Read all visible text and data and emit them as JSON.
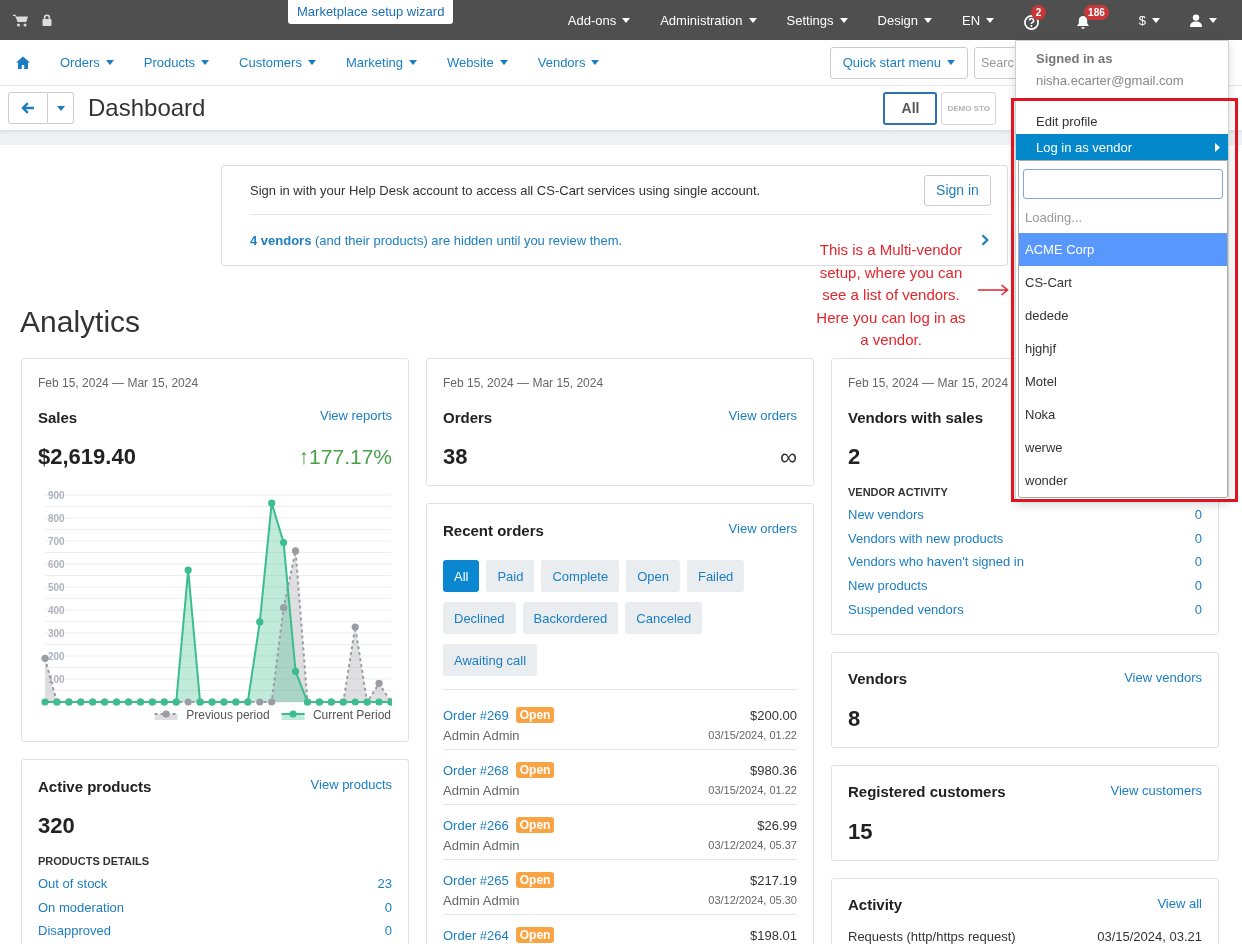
{
  "top_bar": {
    "wizard_tab": "Marketplace setup wizard",
    "items": [
      {
        "kind": "menu",
        "label": "Add-ons"
      },
      {
        "kind": "menu",
        "label": "Administration"
      },
      {
        "kind": "menu",
        "label": "Settings"
      },
      {
        "kind": "menu",
        "label": "Design"
      },
      {
        "kind": "menu",
        "label": "EN"
      },
      {
        "kind": "help",
        "badge": "2"
      },
      {
        "kind": "notifications",
        "badge": "186"
      },
      {
        "kind": "menu",
        "label": "$"
      },
      {
        "kind": "user",
        "expanded": true,
        "menu": {
          "signed_in_label": "Signed in as",
          "email": "nisha.ecarter@gmail.com",
          "items": [
            {
              "label": "Edit profile",
              "selected": false,
              "has_submenu": false
            },
            {
              "label": "Log in as vendor",
              "selected": true,
              "has_submenu": true,
              "submenu": {
                "status": "Loading...",
                "options": [
                  {
                    "label": "ACME Corp",
                    "selected": true
                  },
                  {
                    "label": "CS-Cart",
                    "selected": false
                  },
                  {
                    "label": "dedede",
                    "selected": false
                  },
                  {
                    "label": "hjghjf",
                    "selected": false
                  },
                  {
                    "label": "Motel",
                    "selected": false
                  },
                  {
                    "label": "Noka",
                    "selected": false
                  },
                  {
                    "label": "werwe",
                    "selected": false
                  },
                  {
                    "label": "wonder",
                    "selected": false
                  }
                ]
              }
            }
          ]
        }
      }
    ]
  },
  "nav": {
    "items": [
      "Orders",
      "Products",
      "Customers",
      "Marketing",
      "Website",
      "Vendors"
    ],
    "quick_start": "Quick start menu",
    "search": {
      "placeholder": "Searc"
    }
  },
  "title_bar": {
    "title": "Dashboard",
    "storefronts": [
      {
        "label": "All",
        "selected": true
      },
      {
        "label": "DEMO STO",
        "selected": false
      }
    ]
  },
  "notice": {
    "text": "Sign in with your Help Desk account to access all CS-Cart services using single account.",
    "button": "Sign in",
    "vendors_text": "**4 vendors** (and their products) are hidden until you review them."
  },
  "analytics": {
    "title": "Analytics",
    "columns": [
      [
        {
          "kind": "sales",
          "date": "Feb 15, 2024 — Mar 15, 2024",
          "title": "Sales",
          "link": "View reports",
          "value": "$2,619.40",
          "change": "↑177.17%",
          "chart_data": {
            "type": "area",
            "ylim": [
              0,
              900
            ],
            "yticks": [
              100,
              200,
              300,
              400,
              500,
              600,
              700,
              800,
              900
            ],
            "grid": true,
            "legend": true,
            "series": [
              {
                "name": "Previous period",
                "color": "#9a9da3",
                "values": [
                  190,
                  0,
                  0,
                  0,
                  0,
                  0,
                  0,
                  0,
                  0,
                  0,
                  0,
                  0,
                  0,
                  0,
                  0,
                  0,
                  0,
                  0,
                  0,
                  0,
                  410,
                  657,
                  0,
                  0,
                  0,
                  0,
                  326,
                  0,
                  81,
                  0
                ]
              },
              {
                "name": "Current Period",
                "color": "#3bbd8d",
                "values": [
                  0,
                  0,
                  0,
                  0,
                  0,
                  0,
                  0,
                  0,
                  0,
                  0,
                  0,
                  0,
                  574,
                  0,
                  0,
                  0,
                  0,
                  0,
                  348,
                  865,
                  693,
                  133,
                  0,
                  0,
                  0,
                  0,
                  0,
                  0,
                  0,
                  0
                ]
              }
            ]
          }
        },
        {
          "kind": "details",
          "title": "Active products",
          "link": "View products",
          "value": "320",
          "section": "PRODUCTS DETAILS",
          "rows": [
            {
              "label": "Out of stock",
              "count": "23"
            },
            {
              "label": "On moderation",
              "count": "0"
            },
            {
              "label": "Disapproved",
              "count": "0"
            }
          ]
        }
      ],
      [
        {
          "kind": "counter",
          "date": "Feb 15, 2024 — Mar 15, 2024",
          "title": "Orders",
          "link": "View orders",
          "value": "38",
          "trend": "∞"
        },
        {
          "kind": "orders",
          "title": "Recent orders",
          "link": "View orders",
          "filters": [
            {
              "label": "All",
              "selected": true
            },
            {
              "label": "Paid",
              "selected": false
            },
            {
              "label": "Complete",
              "selected": false
            },
            {
              "label": "Open",
              "selected": false
            },
            {
              "label": "Failed",
              "selected": false
            },
            {
              "label": "Declined",
              "selected": false
            },
            {
              "label": "Backordered",
              "selected": false
            },
            {
              "label": "Canceled",
              "selected": false
            },
            {
              "label": "Awaiting call",
              "selected": false
            }
          ],
          "orders": [
            {
              "number": "Order #269",
              "status": "Open",
              "total": "$200.00",
              "customer": "Admin Admin",
              "date": "03/15/2024, 01.22"
            },
            {
              "number": "Order #268",
              "status": "Open",
              "total": "$980.36",
              "customer": "Admin Admin",
              "date": "03/15/2024, 01.22"
            },
            {
              "number": "Order #266",
              "status": "Open",
              "total": "$26.99",
              "customer": "Admin Admin",
              "date": "03/12/2024, 05.37"
            },
            {
              "number": "Order #265",
              "status": "Open",
              "total": "$217.19",
              "customer": "Admin Admin",
              "date": "03/12/2024, 05.30"
            },
            {
              "number": "Order #264",
              "status": "Open",
              "total": "$198.01"
            }
          ]
        }
      ],
      [
        {
          "kind": "details",
          "date": "Feb 15, 2024 — Mar 15, 2024",
          "title": "Vendors with sales",
          "value": "2",
          "section": "VENDOR ACTIVITY",
          "rows": [
            {
              "label": "New vendors",
              "count": "0"
            },
            {
              "label": "Vendors with new products",
              "count": "0"
            },
            {
              "label": "Vendors who haven't signed in",
              "count": "0"
            },
            {
              "label": "New products",
              "count": "0"
            },
            {
              "label": "Suspended vendors",
              "count": "0"
            }
          ]
        },
        {
          "kind": "counter",
          "title": "Vendors",
          "link": "View vendors",
          "value": "8"
        },
        {
          "kind": "counter",
          "title": "Registered customers",
          "link": "View customers",
          "value": "15"
        },
        {
          "kind": "activity",
          "title": "Activity",
          "link": "View all",
          "rows": [
            {
              "label": "Requests (http/https request)",
              "value": "03/15/2024, 03.21"
            }
          ]
        }
      ]
    ]
  },
  "annotation": {
    "lines": [
      "This is a Multi-vendor",
      "setup, where you can",
      "see a list of vendors.",
      "Here you can log in as",
      "a vendor."
    ]
  }
}
